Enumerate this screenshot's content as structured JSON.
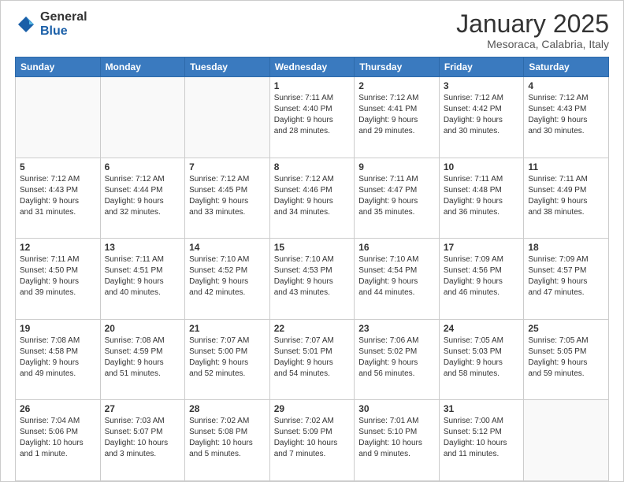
{
  "logo": {
    "general": "General",
    "blue": "Blue"
  },
  "header": {
    "title": "January 2025",
    "subtitle": "Mesoraca, Calabria, Italy"
  },
  "days_of_week": [
    "Sunday",
    "Monday",
    "Tuesday",
    "Wednesday",
    "Thursday",
    "Friday",
    "Saturday"
  ],
  "weeks": [
    [
      {
        "day": "",
        "info": ""
      },
      {
        "day": "",
        "info": ""
      },
      {
        "day": "",
        "info": ""
      },
      {
        "day": "1",
        "info": "Sunrise: 7:11 AM\nSunset: 4:40 PM\nDaylight: 9 hours\nand 28 minutes."
      },
      {
        "day": "2",
        "info": "Sunrise: 7:12 AM\nSunset: 4:41 PM\nDaylight: 9 hours\nand 29 minutes."
      },
      {
        "day": "3",
        "info": "Sunrise: 7:12 AM\nSunset: 4:42 PM\nDaylight: 9 hours\nand 30 minutes."
      },
      {
        "day": "4",
        "info": "Sunrise: 7:12 AM\nSunset: 4:43 PM\nDaylight: 9 hours\nand 30 minutes."
      }
    ],
    [
      {
        "day": "5",
        "info": "Sunrise: 7:12 AM\nSunset: 4:43 PM\nDaylight: 9 hours\nand 31 minutes."
      },
      {
        "day": "6",
        "info": "Sunrise: 7:12 AM\nSunset: 4:44 PM\nDaylight: 9 hours\nand 32 minutes."
      },
      {
        "day": "7",
        "info": "Sunrise: 7:12 AM\nSunset: 4:45 PM\nDaylight: 9 hours\nand 33 minutes."
      },
      {
        "day": "8",
        "info": "Sunrise: 7:12 AM\nSunset: 4:46 PM\nDaylight: 9 hours\nand 34 minutes."
      },
      {
        "day": "9",
        "info": "Sunrise: 7:11 AM\nSunset: 4:47 PM\nDaylight: 9 hours\nand 35 minutes."
      },
      {
        "day": "10",
        "info": "Sunrise: 7:11 AM\nSunset: 4:48 PM\nDaylight: 9 hours\nand 36 minutes."
      },
      {
        "day": "11",
        "info": "Sunrise: 7:11 AM\nSunset: 4:49 PM\nDaylight: 9 hours\nand 38 minutes."
      }
    ],
    [
      {
        "day": "12",
        "info": "Sunrise: 7:11 AM\nSunset: 4:50 PM\nDaylight: 9 hours\nand 39 minutes."
      },
      {
        "day": "13",
        "info": "Sunrise: 7:11 AM\nSunset: 4:51 PM\nDaylight: 9 hours\nand 40 minutes."
      },
      {
        "day": "14",
        "info": "Sunrise: 7:10 AM\nSunset: 4:52 PM\nDaylight: 9 hours\nand 42 minutes."
      },
      {
        "day": "15",
        "info": "Sunrise: 7:10 AM\nSunset: 4:53 PM\nDaylight: 9 hours\nand 43 minutes."
      },
      {
        "day": "16",
        "info": "Sunrise: 7:10 AM\nSunset: 4:54 PM\nDaylight: 9 hours\nand 44 minutes."
      },
      {
        "day": "17",
        "info": "Sunrise: 7:09 AM\nSunset: 4:56 PM\nDaylight: 9 hours\nand 46 minutes."
      },
      {
        "day": "18",
        "info": "Sunrise: 7:09 AM\nSunset: 4:57 PM\nDaylight: 9 hours\nand 47 minutes."
      }
    ],
    [
      {
        "day": "19",
        "info": "Sunrise: 7:08 AM\nSunset: 4:58 PM\nDaylight: 9 hours\nand 49 minutes."
      },
      {
        "day": "20",
        "info": "Sunrise: 7:08 AM\nSunset: 4:59 PM\nDaylight: 9 hours\nand 51 minutes."
      },
      {
        "day": "21",
        "info": "Sunrise: 7:07 AM\nSunset: 5:00 PM\nDaylight: 9 hours\nand 52 minutes."
      },
      {
        "day": "22",
        "info": "Sunrise: 7:07 AM\nSunset: 5:01 PM\nDaylight: 9 hours\nand 54 minutes."
      },
      {
        "day": "23",
        "info": "Sunrise: 7:06 AM\nSunset: 5:02 PM\nDaylight: 9 hours\nand 56 minutes."
      },
      {
        "day": "24",
        "info": "Sunrise: 7:05 AM\nSunset: 5:03 PM\nDaylight: 9 hours\nand 58 minutes."
      },
      {
        "day": "25",
        "info": "Sunrise: 7:05 AM\nSunset: 5:05 PM\nDaylight: 9 hours\nand 59 minutes."
      }
    ],
    [
      {
        "day": "26",
        "info": "Sunrise: 7:04 AM\nSunset: 5:06 PM\nDaylight: 10 hours\nand 1 minute."
      },
      {
        "day": "27",
        "info": "Sunrise: 7:03 AM\nSunset: 5:07 PM\nDaylight: 10 hours\nand 3 minutes."
      },
      {
        "day": "28",
        "info": "Sunrise: 7:02 AM\nSunset: 5:08 PM\nDaylight: 10 hours\nand 5 minutes."
      },
      {
        "day": "29",
        "info": "Sunrise: 7:02 AM\nSunset: 5:09 PM\nDaylight: 10 hours\nand 7 minutes."
      },
      {
        "day": "30",
        "info": "Sunrise: 7:01 AM\nSunset: 5:10 PM\nDaylight: 10 hours\nand 9 minutes."
      },
      {
        "day": "31",
        "info": "Sunrise: 7:00 AM\nSunset: 5:12 PM\nDaylight: 10 hours\nand 11 minutes."
      },
      {
        "day": "",
        "info": ""
      }
    ]
  ]
}
